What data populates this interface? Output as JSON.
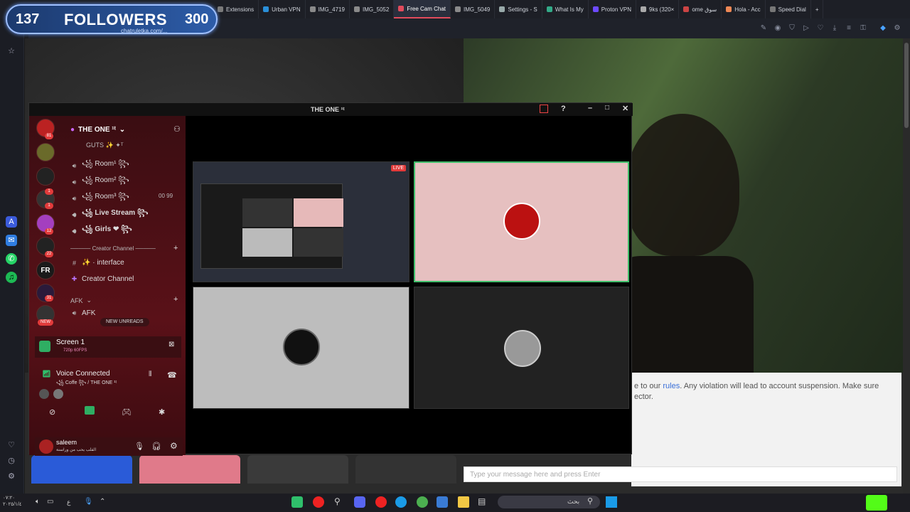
{
  "browser": {
    "tabs": [
      {
        "label": "Extensions",
        "color": "#7a7a7a"
      },
      {
        "label": "Urban VPN",
        "color": "#2a8fd8"
      },
      {
        "label": "IMG_4719",
        "color": "#8a8a8a"
      },
      {
        "label": "IMG_5052",
        "color": "#8a8a8a"
      },
      {
        "label": "Free Cam Chat",
        "color": "#e24b5c",
        "active": true
      },
      {
        "label": "IMG_5049",
        "color": "#8a8a8a"
      },
      {
        "label": "Settings - S",
        "color": "#9aa"
      },
      {
        "label": "What Is My",
        "color": "#3a8"
      },
      {
        "label": "Proton VPN",
        "color": "#6d4aff"
      },
      {
        "label": "9ks (320×",
        "color": "#aaa"
      },
      {
        "label": "ome سوق",
        "color": "#c44"
      },
      {
        "label": "Hola - Acc",
        "color": "#e85"
      },
      {
        "label": "Speed Dial",
        "color": "#777"
      }
    ]
  },
  "followers": {
    "count_left": "137",
    "label": "FOLLOWERS",
    "count_right": "300",
    "url": "chatruletka.com/..."
  },
  "discord": {
    "window_title": "THE ONE ¹ᵗ",
    "server_name": "THE ONE ¹ᵗ",
    "member_line": "GUTS ✨ ✦ᵀ",
    "channels": [
      {
        "icon": "speaker",
        "label": "꧁ Room¹ ꧂"
      },
      {
        "icon": "speaker",
        "label": "꧁ Room² ꧂"
      },
      {
        "icon": "speaker",
        "label": "꧁ Room³ ꧂",
        "extra": "00  99"
      },
      {
        "icon": "speaker",
        "label": "꧁ Live Stream ꧂"
      },
      {
        "icon": "speaker",
        "label": "꧁ Girls ❤ ꧂"
      }
    ],
    "category_creator": "───── Creator Channel ─────",
    "text_channels": [
      {
        "icon": "#",
        "label": "✨ · interface"
      },
      {
        "icon": "✚",
        "label": "Creator Channel"
      }
    ],
    "category_afk": "AFK",
    "afk_channel": "AFK",
    "new_unreads": "NEW UNREADS",
    "new_badge": "NEW",
    "fr_label": "FR",
    "screen_share": {
      "title": "Screen 1",
      "sub": "720p 60FPS"
    },
    "voice": {
      "status": "Voice Connected",
      "channel": "꧁ Coffe ꧂ / THE ONE ¹ᵗ"
    },
    "user": {
      "name": "saleem",
      "status": "القلب يحب من وراسنة"
    },
    "live_badge": "LIVE",
    "server_badges": [
      "81",
      "",
      "1",
      "1",
      "12",
      "22",
      "",
      "31"
    ]
  },
  "chat": {
    "rules_prefix": "e to our ",
    "rules_link": "rules",
    "rules_suffix": ". Any violation will lead to account suspension. Make sure",
    "rules_line2": "ector.",
    "input_placeholder": "Type your message here and press Enter"
  },
  "taskbar": {
    "search_text": "بحث",
    "lang": "ع",
    "clock_top": "٠٧:٢٠",
    "clock_bottom": "٢٠٢٥/١/٤"
  },
  "colors": {
    "discord_red": "#5a1118",
    "accent_live": "#e23b3b",
    "active_tab": "#e24b5c"
  }
}
